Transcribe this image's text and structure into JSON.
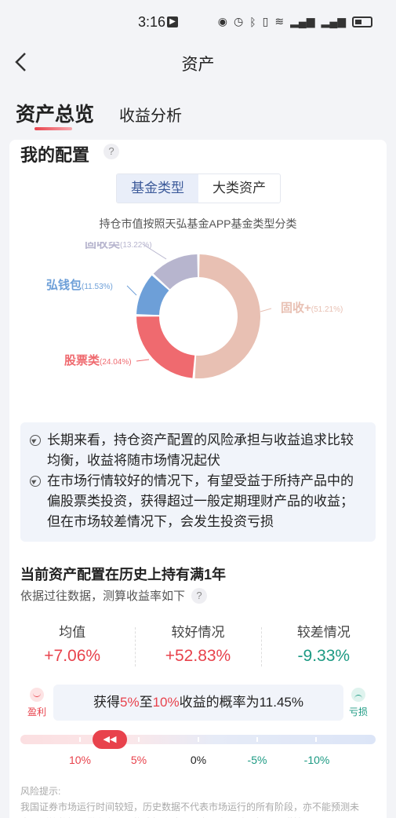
{
  "status_bar": {
    "time": "3:16"
  },
  "nav": {
    "title": "资产"
  },
  "tabs": {
    "active": "资产总览",
    "inactive": "收益分析"
  },
  "allocation": {
    "title": "我的配置",
    "help": "?",
    "segments": [
      "基金类型",
      "大类资产"
    ],
    "caption": "持仓市值按照天弘基金APP基金类型分类"
  },
  "chart_data": {
    "type": "pie",
    "categories": [
      "固收+",
      "股票类",
      "弘钱包",
      "固收类"
    ],
    "values": [
      51.21,
      24.04,
      11.53,
      13.22
    ],
    "labels": [
      {
        "name": "固收+",
        "pct": "(51.21%)"
      },
      {
        "name": "股票类",
        "pct": "(24.04%)"
      },
      {
        "name": "弘钱包",
        "pct": "(11.53%)"
      },
      {
        "name": "固收类",
        "pct": "(13.22%)"
      }
    ],
    "colors": [
      "#e8c0b3",
      "#ef6a6f",
      "#6d9fd8",
      "#b7b5ce"
    ]
  },
  "tips": [
    "长期来看，持仓资产配置的风险承担与收益追求比较均衡，收益将随市场情况起伏",
    "在市场行情较好的情况下，有望受益于所持产品中的偏股票类投资，获得超过一般定期理财产品的收益；但在市场较差情况下，会发生投资亏损"
  ],
  "history": {
    "title": "当前资产配置在历史上持有满1年",
    "subtitle": "依据过往数据，测算收益率如下",
    "help": "?",
    "stats": [
      {
        "label": "均值",
        "value": "+7.06%",
        "tone": "red"
      },
      {
        "label": "较好情况",
        "value": "+52.83%",
        "tone": "red"
      },
      {
        "label": "较差情况",
        "value": "-9.33%",
        "tone": "green"
      }
    ]
  },
  "probability": {
    "profit_label": "盈利",
    "loss_label": "亏损",
    "text_prefix": "获得",
    "low": "5%",
    "mid": "至",
    "high": "10%",
    "text_suffix": "收益的概率为11.45%",
    "thumb": "◀◀",
    "scale": [
      "10%",
      "5%",
      "0%",
      "-5%",
      "-10%"
    ]
  },
  "risk": {
    "title": "风险提示:",
    "text": "我国证券市场运行时间较短，历史数据不代表市场运行的所有阶段，亦不能预测未来，测算数据仅供参考，不构成投资建议。市场有风险，投资需谨慎。"
  },
  "colors": {
    "accent": "#e8424c",
    "green": "#1c9a83",
    "seg_active_bg": "#e9eef9"
  }
}
